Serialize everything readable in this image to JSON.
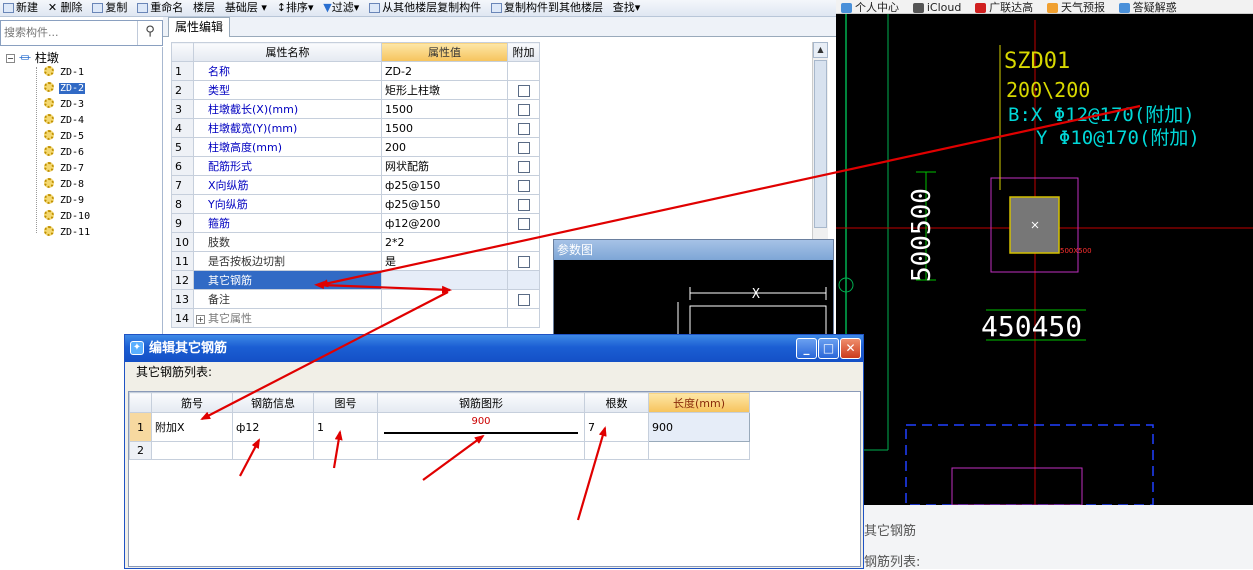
{
  "toolbar": {
    "items": [
      "新建",
      "删除",
      "复制",
      "重命名",
      "楼层",
      "基础层",
      "排序",
      "过滤",
      "从其他楼层复制构件",
      "复制构件到其他楼层",
      "查找"
    ]
  },
  "search": {
    "placeholder": "搜索构件..."
  },
  "tree": {
    "root": "柱墩",
    "items": [
      "ZD-1",
      "ZD-2",
      "ZD-3",
      "ZD-4",
      "ZD-5",
      "ZD-6",
      "ZD-7",
      "ZD-8",
      "ZD-9",
      "ZD-10",
      "ZD-11"
    ],
    "selected": "ZD-2"
  },
  "tab": {
    "label": "属性编辑"
  },
  "props": {
    "headers": {
      "name": "属性名称",
      "value": "属性值",
      "attach": "附加"
    },
    "rows": [
      {
        "no": "1",
        "name": "名称",
        "value": "ZD-2"
      },
      {
        "no": "2",
        "name": "类型",
        "value": "矩形上柱墩"
      },
      {
        "no": "3",
        "name": "柱墩截长(X)(mm)",
        "value": "1500"
      },
      {
        "no": "4",
        "name": "柱墩截宽(Y)(mm)",
        "value": "1500"
      },
      {
        "no": "5",
        "name": "柱墩高度(mm)",
        "value": "200"
      },
      {
        "no": "6",
        "name": "配筋形式",
        "value": "网状配筋"
      },
      {
        "no": "7",
        "name": "X向纵筋",
        "value": "ф25@150"
      },
      {
        "no": "8",
        "name": "Y向纵筋",
        "value": "ф25@150"
      },
      {
        "no": "9",
        "name": "箍筋",
        "value": "ф12@200"
      },
      {
        "no": "10",
        "name": "肢数",
        "value": "2*2"
      },
      {
        "no": "11",
        "name": "是否按板边切割",
        "value": "是"
      },
      {
        "no": "12",
        "name": "其它钢筋",
        "value": ""
      },
      {
        "no": "13",
        "name": "备注",
        "value": ""
      },
      {
        "no": "14",
        "name": "其它属性",
        "value": ""
      }
    ]
  },
  "param": {
    "title": "参数图",
    "x_label": "X"
  },
  "browser": {
    "bookmarks": [
      "个人中心",
      "iCloud",
      "广联达高",
      "天气预报",
      "答疑解惑"
    ]
  },
  "cad": {
    "label1": "SZD01",
    "label2": "200\\200",
    "label3": "B:X Φ12@170(附加)",
    "label4": "Y Φ10@170(附加)",
    "dim_v": "500500",
    "dim_h": "450450",
    "small": "500X500"
  },
  "bg": {
    "t1": "其它钢筋",
    "t2": "钢筋列表:"
  },
  "dialog": {
    "title": "编辑其它钢筋",
    "subtitle": "其它钢筋列表:",
    "headers": [
      "筋号",
      "钢筋信息",
      "图号",
      "钢筋图形",
      "根数",
      "长度(mm)"
    ],
    "row1": {
      "no": "1",
      "bar_no": "附加X",
      "info": "ф12",
      "fig": "1",
      "shape_value": "900",
      "count": "7",
      "length": "900"
    },
    "row2": {
      "no": "2"
    }
  },
  "colors": {
    "arrow": "#e00000",
    "selection": "#316ac5",
    "title_bar": "#1b5ed3",
    "header_highlight": "#f6c35c"
  }
}
